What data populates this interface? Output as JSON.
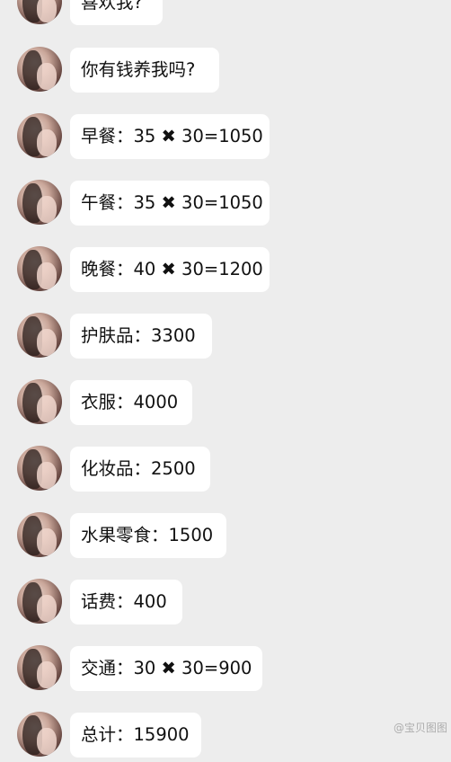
{
  "messages": [
    {
      "text": "喜欢我?"
    },
    {
      "text": "你有钱养我吗?"
    },
    {
      "text": "早餐：35 ✖ 30=1050"
    },
    {
      "text": "午餐：35 ✖ 30=1050"
    },
    {
      "text": "晚餐：40 ✖ 30=1200"
    },
    {
      "text": "护肤品：3300"
    },
    {
      "text": "衣服：4000"
    },
    {
      "text": "化妆品：2500"
    },
    {
      "text": "水果零食：1500"
    },
    {
      "text": "话费：400"
    },
    {
      "text": "交通：30 ✖ 30=900"
    },
    {
      "text": "总计：15900"
    }
  ],
  "watermark": "@宝贝图图"
}
